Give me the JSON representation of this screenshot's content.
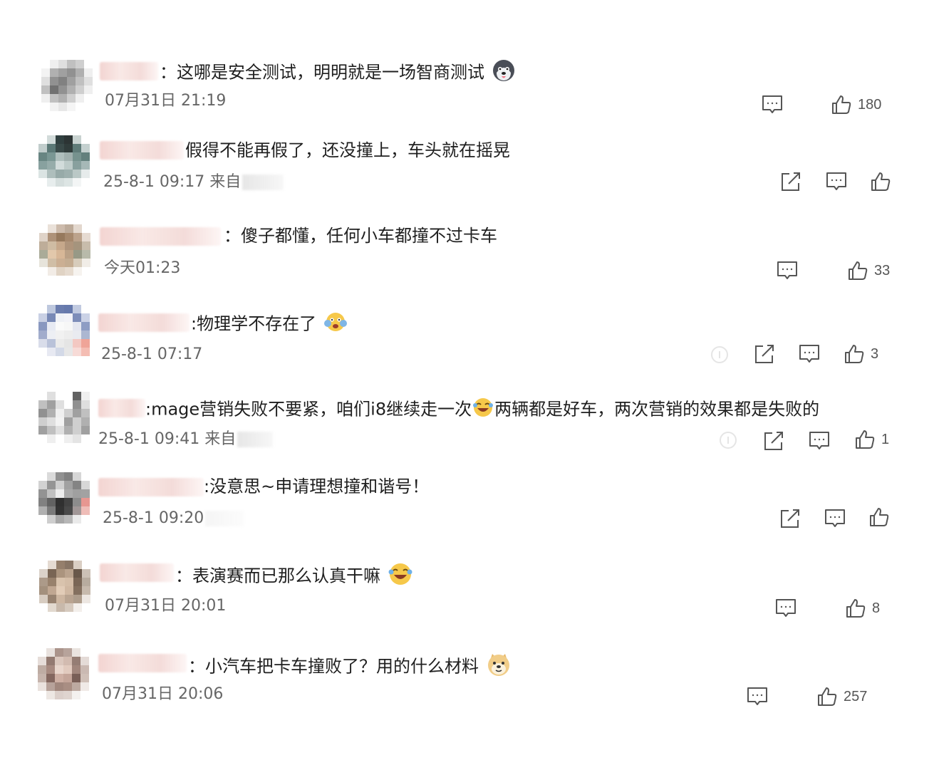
{
  "comments": [
    {
      "text": "：这哪是安全测试，明明就是一场智商测试",
      "emoji": "husky-emoji-icon",
      "meta": "07月31日 21:19",
      "likes": "180"
    },
    {
      "text": "假得不能再假了，还没撞上，车头就在摇晃",
      "meta": "25-8-1 09:17 来自"
    },
    {
      "text": "：傻子都懂，任何小车都撞不过卡车",
      "meta": "今天01:23",
      "likes": "33"
    },
    {
      "text": ":物理学不存在了",
      "emoji": "scared-emoji-icon",
      "meta": "25-8-1 07:17",
      "likes": "3"
    },
    {
      "text": ":mage营销失败不要紧，咱们i8继续走一次",
      "text2": "两辆都是好车，两次营销的效果都是失败的",
      "emoji": "laugh-cry-emoji-icon",
      "meta": "25-8-1 09:41 来自",
      "likes": "1"
    },
    {
      "text": ":没意思~申请理想撞和谐号！",
      "meta": "25-8-1 09:20"
    },
    {
      "text": "：表演赛而已那么认真干嘛",
      "emoji": "laugh-cry-emoji-icon",
      "meta": "07月31日 20:01",
      "likes": "8"
    },
    {
      "text": "：小汽车把卡车撞败了？用的什么材料",
      "emoji": "doge-emoji-icon",
      "meta": "07月31日 20:06",
      "likes": "257"
    }
  ],
  "icons": {
    "share": "share-icon",
    "comment": "comment-icon",
    "like": "thumbs-up-icon"
  }
}
